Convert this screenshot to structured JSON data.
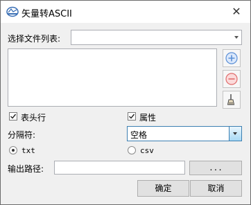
{
  "window": {
    "title": "矢量转ASCII"
  },
  "file_list": {
    "label": "选择文件列表:",
    "selected": ""
  },
  "options": {
    "header_label": "表头行",
    "header_checked": true,
    "attr_label": "属性",
    "attr_checked": true
  },
  "separator": {
    "label": "分隔符:",
    "value": "空格"
  },
  "format": {
    "txt_label": "txt",
    "csv_label": "csv",
    "selected": "txt"
  },
  "output": {
    "label": "输出路径:",
    "value": "",
    "browse_label": "..."
  },
  "buttons": {
    "ok": "确定",
    "cancel": "取消"
  },
  "icons": {
    "app": "vector-app-icon",
    "close": "close-icon",
    "add": "plus-circle-icon",
    "remove": "minus-circle-icon",
    "clear": "broom-icon"
  },
  "colors": {
    "add_blue": "#5b8fd6",
    "remove_red": "#e06c6c",
    "focus_border": "#3c7fb1"
  }
}
